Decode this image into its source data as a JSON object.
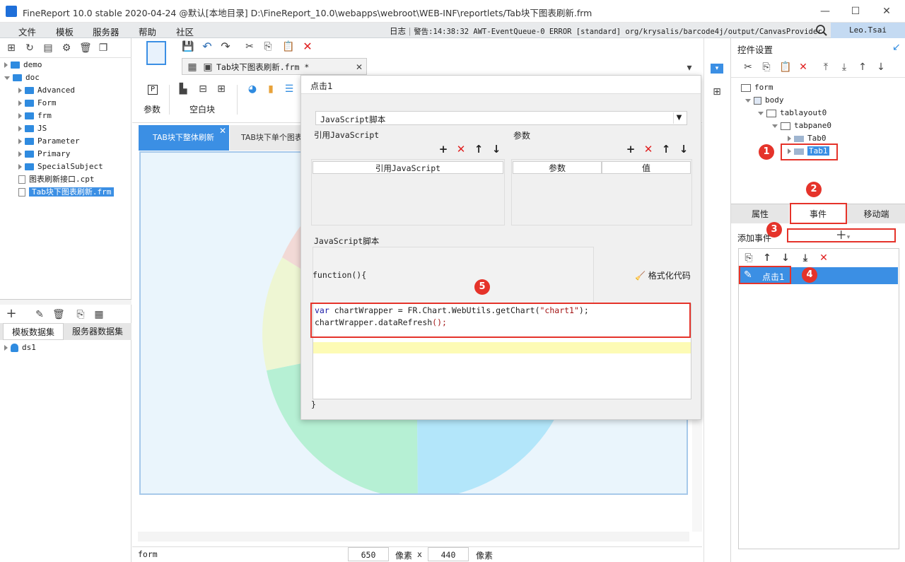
{
  "titlebar": {
    "title": "FineReport 10.0 stable 2020-04-24 @默认[本地目录]    D:\\FineReport_10.0\\webapps\\webroot\\WEB-INF\\reportlets/Tab块下图表刷新.frm"
  },
  "menubar": {
    "items": [
      "文件",
      "模板",
      "服务器",
      "帮助",
      "社区"
    ],
    "log_label": "日志",
    "log_text": "警告:14:38:32 AWT-EventQueue-0 ERROR [standard] org/krysalis/barcode4j/output/CanvasProvider",
    "user": "Leo.Tsai"
  },
  "filetree": {
    "items": [
      {
        "label": "demo",
        "level": 0,
        "expanded": false,
        "type": "folder"
      },
      {
        "label": "doc",
        "level": 0,
        "expanded": true,
        "type": "folder"
      },
      {
        "label": "Advanced",
        "level": 1,
        "expanded": false,
        "type": "folder"
      },
      {
        "label": "Form",
        "level": 1,
        "expanded": false,
        "type": "folder"
      },
      {
        "label": "frm",
        "level": 1,
        "expanded": false,
        "type": "folder"
      },
      {
        "label": "JS",
        "level": 1,
        "expanded": false,
        "type": "folder"
      },
      {
        "label": "Parameter",
        "level": 1,
        "expanded": false,
        "type": "folder"
      },
      {
        "label": "Primary",
        "level": 1,
        "expanded": false,
        "type": "folder"
      },
      {
        "label": "SpecialSubject",
        "level": 1,
        "expanded": false,
        "type": "folder"
      },
      {
        "label": "图表刷新接口.cpt",
        "level": 0,
        "type": "file"
      },
      {
        "label": "Tab块下图表刷新.frm",
        "level": 0,
        "type": "file",
        "selected": true
      }
    ]
  },
  "datasets": {
    "tabs": [
      "模板数据集",
      "服务器数据集"
    ],
    "items": [
      "ds1"
    ]
  },
  "toolbar": {
    "param_label": "参数",
    "blank_label": "空白块"
  },
  "editor_tab": {
    "label": "Tab块下图表刷新.frm *"
  },
  "canvas_tabs": [
    "TAB块下整体刷新",
    "TAB块下单个图表"
  ],
  "dialog": {
    "title": "点击1",
    "type_select": "JavaScript脚本",
    "ref_js_label": "引用JavaScript",
    "param_label": "参数",
    "ref_js_col": "引用JavaScript",
    "param_col": "参数",
    "value_col": "值",
    "script_label": "JavaScript脚本",
    "func_open": "function(){",
    "format_label": "格式化代码",
    "code_line1_kw": "var",
    "code_line1_rest": " chartWrapper = FR.Chart.WebUtils.getChart(",
    "code_line1_str": "\"chart1\"",
    "code_line1_end": ");",
    "code_line2": "chartWrapper.dataRefresh",
    "code_line2_end": "();",
    "func_close": "}"
  },
  "rightpanel": {
    "title": "控件设置",
    "tree": [
      {
        "label": "form",
        "level": 0
      },
      {
        "label": "body",
        "level": 1
      },
      {
        "label": "tablayout0",
        "level": 2
      },
      {
        "label": "tabpane0",
        "level": 3
      },
      {
        "label": "Tab0",
        "level": 4
      },
      {
        "label": "Tab1",
        "level": 4,
        "selected": true
      }
    ],
    "tabs": [
      "属性",
      "事件",
      "移动端"
    ],
    "add_event_label": "添加事件",
    "event_item": "点击1"
  },
  "badges": [
    "1",
    "2",
    "3",
    "4",
    "5"
  ],
  "statusbar": {
    "left": "form",
    "width": "650",
    "unit1": "像素",
    "x": "x",
    "height": "440",
    "unit2": "像素"
  },
  "colors": {
    "accent": "#3b8fe4",
    "badge_red": "#e5332a",
    "menubar": "#e8eaec",
    "canvas_bg": "#eaf5fc"
  }
}
